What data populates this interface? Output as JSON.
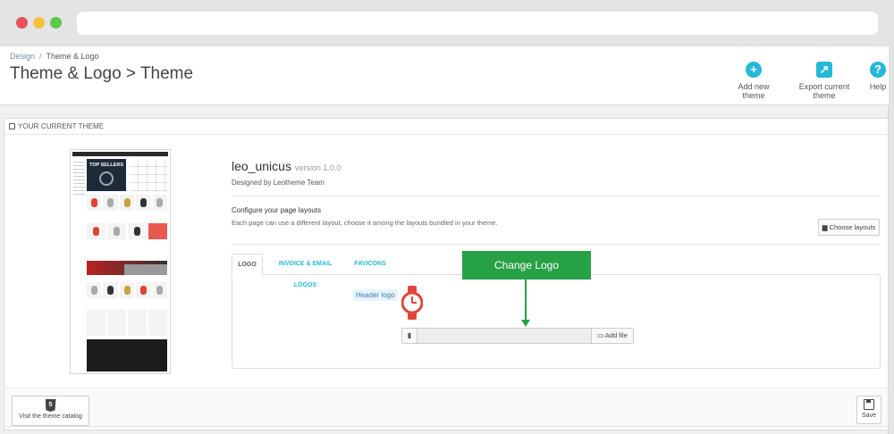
{
  "breadcrumb": {
    "parent": "Design",
    "separator": "/",
    "current": "Theme & Logo"
  },
  "page_title": "Theme & Logo > Theme",
  "toolbar": {
    "add_new_theme": "Add new theme",
    "export_current_theme": "Export current theme",
    "help": "Help",
    "add_icon": "+",
    "export_icon": "↗",
    "help_icon": "?"
  },
  "panel": {
    "heading": "YOUR CURRENT THEME",
    "preview_banner": "TOP SELLERS",
    "theme_name": "leo_unicus",
    "theme_version": "version 1.0.0",
    "designed_by": "Designed by Leotheme Team",
    "layouts_title": "Configure your page layouts",
    "layouts_desc": "Each page can use a different layout, choose it among the layouts bundled in your theme.",
    "choose_layouts": "Choose layouts",
    "tabs": [
      "LOGO",
      "INVOICE & EMAIL LOGOS",
      "FAVICONS"
    ],
    "header_logo_label": "Header logo",
    "add_file": "Add file"
  },
  "callout": {
    "text": "Change Logo"
  },
  "footer": {
    "visit_catalog": "Visit the theme catalog",
    "save": "Save",
    "html5_badge": "5"
  },
  "colors": {
    "accent": "#25b9d7",
    "callout": "#27a146",
    "logo_red": "#e2453c"
  }
}
